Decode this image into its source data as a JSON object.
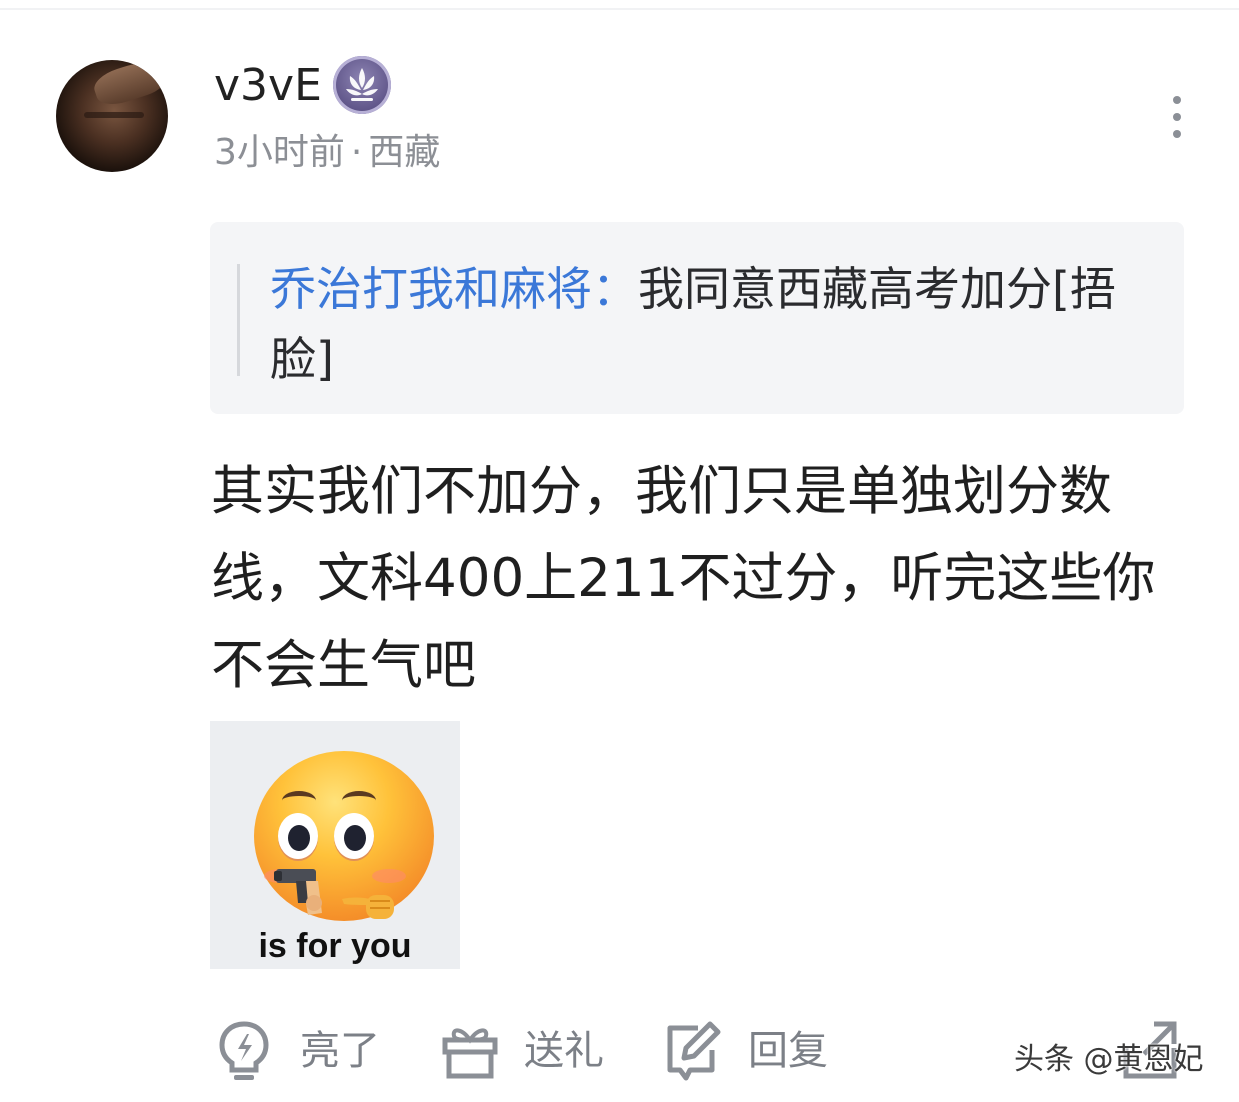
{
  "comment": {
    "username": "v3vE",
    "time": "3小时前",
    "location": "西藏",
    "separator": "·",
    "quote": {
      "author": "乔治打我和麻将",
      "colon": "：",
      "text": "我同意西藏高考加分[捂脸]"
    },
    "content": "其实我们不加分，我们只是单独划分数线，文科400上211不过分，听完这些你不会生气吧",
    "sticker_caption": "is for you"
  },
  "actions": {
    "like_label": "亮了",
    "gift_label": "送礼",
    "reply_label": "回复"
  },
  "watermark": "头条 @黄恩妃",
  "icons": {
    "like": "lightbulb-icon",
    "gift": "gift-icon",
    "reply": "edit-reply-icon",
    "share": "share-icon",
    "more": "more-vertical-icon",
    "badge": "lotus-badge-icon"
  },
  "colors": {
    "author_link": "#3b78d8",
    "quote_bg": "#f4f5f7",
    "meta_text": "#8c8f95",
    "action_icon": "#8b8f96"
  }
}
